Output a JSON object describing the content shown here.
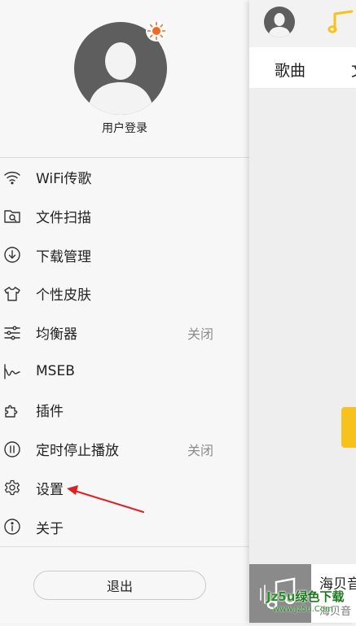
{
  "drawer": {
    "login_label": "用户登录",
    "menu": [
      {
        "label": "WiFi传歌",
        "status": "",
        "icon": "wifi-icon"
      },
      {
        "label": "文件扫描",
        "status": "",
        "icon": "scan-icon"
      },
      {
        "label": "下载管理",
        "status": "",
        "icon": "download-icon"
      },
      {
        "label": "个性皮肤",
        "status": "",
        "icon": "tshirt-icon"
      },
      {
        "label": "均衡器",
        "status": "关闭",
        "icon": "equalizer-icon"
      },
      {
        "label": "MSEB",
        "status": "",
        "icon": "mseb-icon"
      },
      {
        "label": "插件",
        "status": "",
        "icon": "plugin-icon"
      },
      {
        "label": "定时停止播放",
        "status": "关闭",
        "icon": "timer-icon"
      },
      {
        "label": "设置",
        "status": "",
        "icon": "gear-icon"
      },
      {
        "label": "关于",
        "status": "",
        "icon": "info-icon"
      }
    ],
    "logout_label": "退出",
    "annotation_color": "#e02020"
  },
  "main": {
    "tab_songs": "歌曲",
    "tab_next": "文",
    "player_title": "海贝音",
    "player_sub": "海贝音",
    "accent": "#f7c21b"
  },
  "watermark": {
    "line1_prefix": "Jz5u",
    "line1_cn": "绿色下载",
    "line2": "www.Jz5u.Com"
  }
}
